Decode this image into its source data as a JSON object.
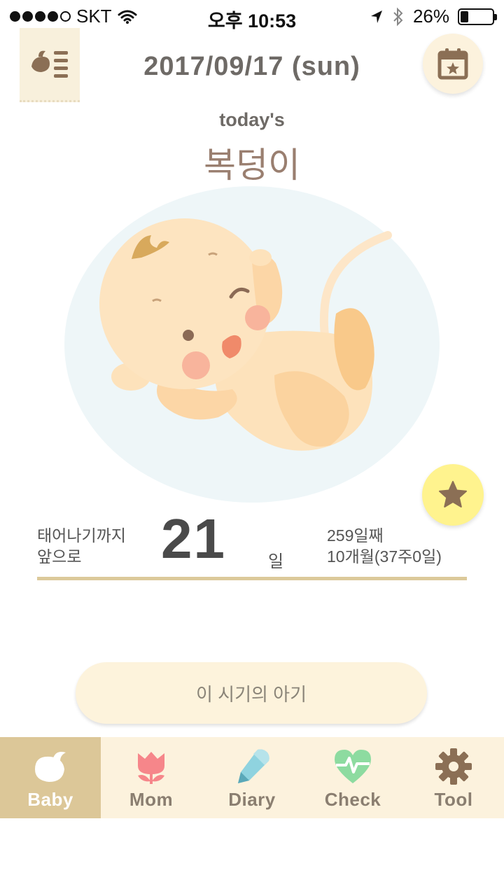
{
  "status_bar": {
    "carrier": "SKT",
    "time": "오후 10:53",
    "battery_percent": "26%",
    "battery_level": 0.26
  },
  "header": {
    "date": "2017/09/17 (sun)",
    "menu_icon": "bird-menu-icon",
    "calendar_icon": "calendar-star-icon"
  },
  "today": {
    "label": "today's",
    "name": "복덩이"
  },
  "info": {
    "until_birth_line1": "태어나기까지",
    "until_birth_line2": "앞으로",
    "days_left": "21",
    "days_unit": "일",
    "day_count": "259일째",
    "month_week": "10개월(37주0일)"
  },
  "cta": {
    "label": "이 시기의 아기"
  },
  "tabs": [
    {
      "label": "Baby",
      "icon": "bird-icon",
      "active": true
    },
    {
      "label": "Mom",
      "icon": "tulip-icon",
      "active": false
    },
    {
      "label": "Diary",
      "icon": "pencil-icon",
      "active": false
    },
    {
      "label": "Check",
      "icon": "heartbeat-icon",
      "active": false
    },
    {
      "label": "Tool",
      "icon": "gear-icon",
      "active": false
    }
  ],
  "colors": {
    "accent_brown": "#8b6f55",
    "tab_active": "#dcc798",
    "tab_bar_bg": "#fcf2dd",
    "favorite_bg": "#fff38e",
    "divider": "#dcc99a"
  }
}
